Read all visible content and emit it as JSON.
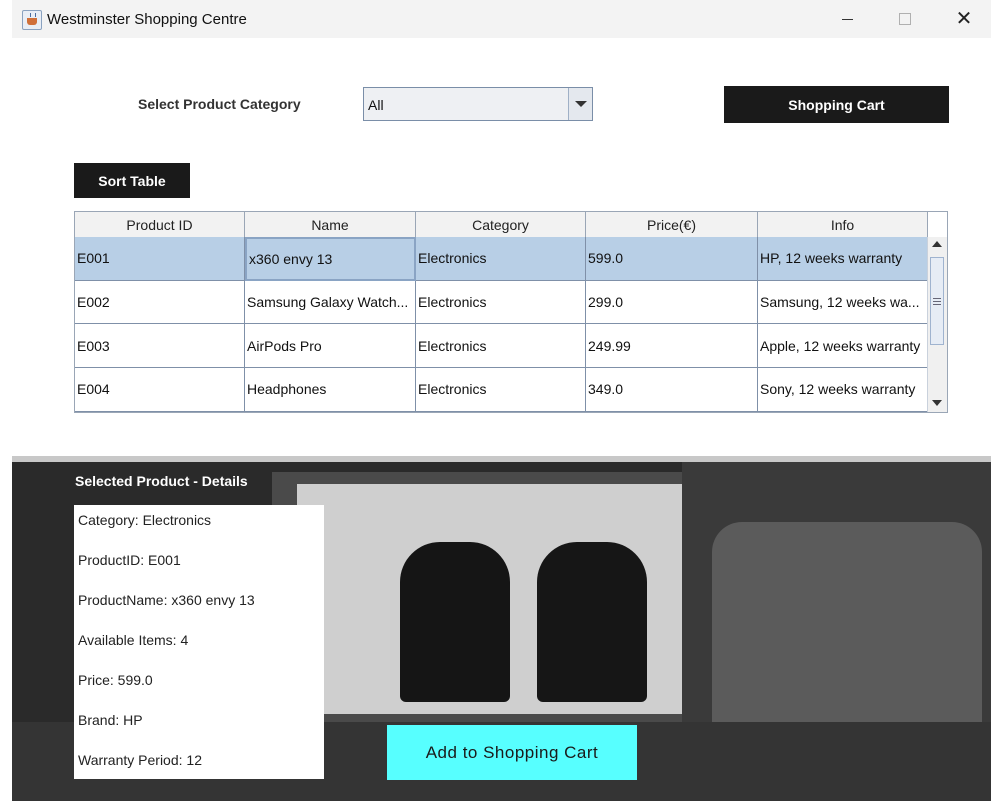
{
  "window": {
    "title": "Westminster Shopping Centre",
    "icon": "java-cup-icon",
    "controls": [
      "minimize-icon",
      "maximize-icon",
      "close-icon"
    ]
  },
  "filter": {
    "label": "Select Product Category",
    "selected": "All"
  },
  "buttons": {
    "shopping_cart": "Shopping Cart",
    "sort_table": "Sort Table",
    "add_to_cart": "Add to Shopping Cart"
  },
  "table": {
    "columns": [
      "Product ID",
      "Name",
      "Category",
      "Price(€)",
      "Info"
    ],
    "rows": [
      [
        "E001",
        "x360 envy 13",
        "Electronics",
        "599.0",
        "HP, 12 weeks warranty"
      ],
      [
        "E002",
        "Samsung Galaxy Watch...",
        "Electronics",
        "299.0",
        "Samsung, 12 weeks wa..."
      ],
      [
        "E003",
        "AirPods Pro",
        "Electronics",
        "249.99",
        "Apple, 12 weeks warranty"
      ],
      [
        "E004",
        "Headphones",
        "Electronics",
        "349.0",
        "Sony, 12 weeks warranty"
      ]
    ],
    "selected_row": 0
  },
  "details": {
    "title": "Selected Product - Details",
    "lines": [
      "Category: Electronics",
      "ProductID: E001",
      "ProductName: x360 envy 13",
      "Available Items: 4",
      "Price: 599.0",
      "Brand: HP",
      "Warranty Period: 12"
    ]
  },
  "colors": {
    "dark_button": "#1a1a1a",
    "add_button": "#57ffff",
    "selected_row": "#b8cfe6"
  }
}
